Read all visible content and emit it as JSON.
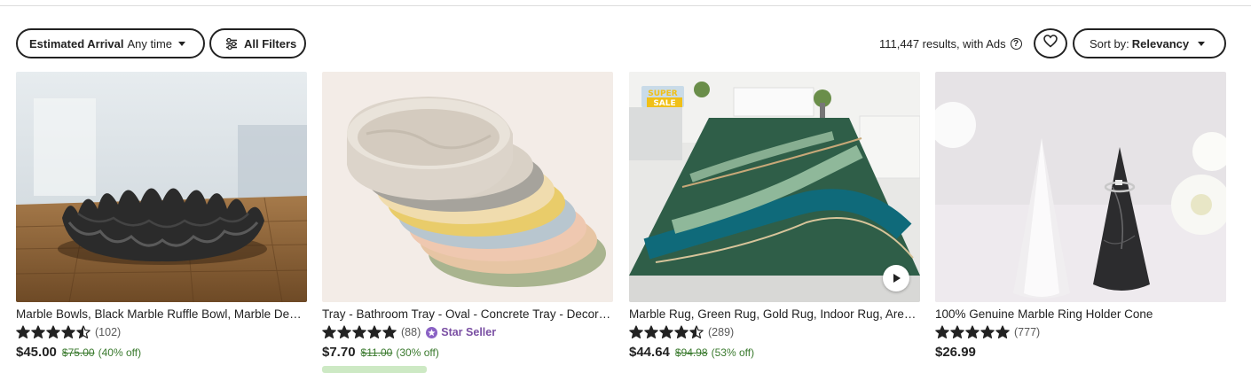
{
  "filters": {
    "arrival_label": "Estimated Arrival",
    "arrival_value": "Any time",
    "all_filters_label": "All Filters"
  },
  "results": {
    "text": "111,447 results, with Ads",
    "help_glyph": "?"
  },
  "sort": {
    "prefix": "Sort by:",
    "value": "Relevancy"
  },
  "colors": {
    "star_fill": "#222222",
    "sale_green": "#3a7a2e",
    "star_seller_purple": "#7a4fa3"
  },
  "products": [
    {
      "title": "Marble Bowls, Black Marble Ruffle Bowl, Marble Decor, Marble Home Decor",
      "rating": 4.5,
      "reviews": "(102)",
      "price": "$45.00",
      "original_price": "$75.00",
      "discount": "(40% off)",
      "star_seller": ""
    },
    {
      "title": "Tray - Bathroom Tray - Oval - Concrete Tray - Decorative Tray",
      "rating": 5,
      "reviews": "(88)",
      "price": "$7.70",
      "original_price": "$11.00",
      "discount": "(30% off)",
      "star_seller": "Star Seller"
    },
    {
      "title": "Marble Rug, Green Rug, Gold Rug, Indoor Rug, Area Rug",
      "rating": 4.5,
      "reviews": "(289)",
      "price": "$44.64",
      "original_price": "$94.98",
      "discount": "(53% off)",
      "star_seller": "",
      "badge_line1": "SUPER",
      "badge_line2": "SALE"
    },
    {
      "title": "100% Genuine Marble Ring Holder Cone",
      "rating": 5,
      "reviews": "(777)",
      "price": "$26.99",
      "original_price": "",
      "discount": "",
      "star_seller": ""
    }
  ]
}
